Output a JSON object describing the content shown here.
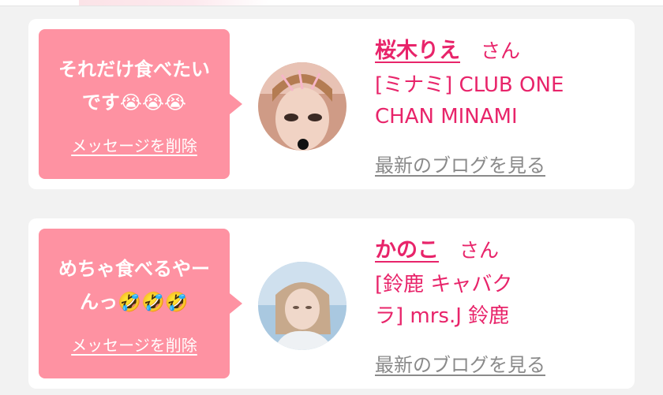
{
  "cards": [
    {
      "message_lines": [
        "それだけ食べたい",
        "です😭😭😭"
      ],
      "delete_label": "メッセージを削除",
      "avatar_icon": "profile-photo",
      "name": "桜木りえ",
      "honorific": "さん",
      "shop_lines": [
        "[ミナミ] CLUB ONE",
        "CHAN MINAMI"
      ],
      "blog_label": "最新のブログを見る"
    },
    {
      "message_lines": [
        "めちゃ食べるやー",
        "んっ🤣🤣🤣"
      ],
      "delete_label": "メッセージを削除",
      "avatar_icon": "profile-photo",
      "name": "かのこ",
      "honorific": "さん",
      "shop_lines": [
        "[鈴鹿 キャバク",
        "ラ] mrs.J 鈴鹿"
      ],
      "blog_label": "最新のブログを見る"
    }
  ],
  "colors": {
    "bubble": "#fe92a2",
    "accent": "#e8246a",
    "link_gray": "#8a8a8a",
    "background": "#f2f2f2"
  }
}
